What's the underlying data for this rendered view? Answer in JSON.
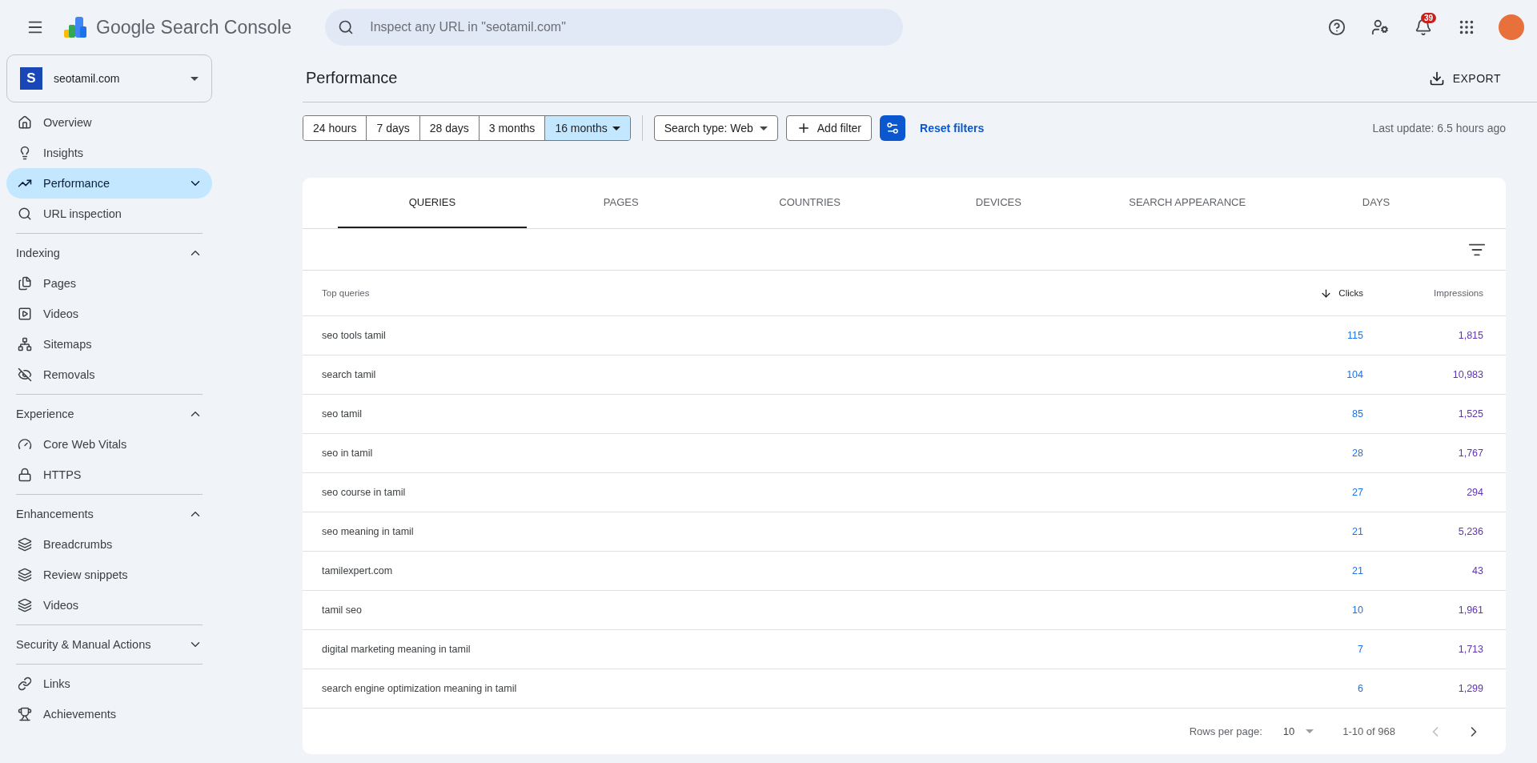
{
  "header": {
    "product": "Google Search Console",
    "search": {
      "placeholder": "Inspect any URL in \"seotamil.com\""
    },
    "notifications": "39"
  },
  "property": {
    "letter": "S",
    "name": "seotamil.com"
  },
  "sidebar": {
    "groups": [
      {
        "items": [
          {
            "label": "Overview",
            "kind": "home",
            "selected": false,
            "expandable": false
          },
          {
            "label": "Insights",
            "kind": "bulb",
            "selected": false,
            "expandable": false
          },
          {
            "label": "Performance",
            "kind": "trend",
            "selected": true,
            "expandable": true
          },
          {
            "label": "URL inspection",
            "kind": "search",
            "selected": false,
            "expandable": false
          }
        ]
      },
      {
        "title": "Indexing",
        "expanded": true,
        "items": [
          {
            "label": "Pages",
            "kind": "pages",
            "selected": false,
            "expandable": false
          },
          {
            "label": "Videos",
            "kind": "video",
            "selected": false,
            "expandable": false
          },
          {
            "label": "Sitemaps",
            "kind": "sitemap",
            "selected": false,
            "expandable": false
          },
          {
            "label": "Removals",
            "kind": "hidden",
            "selected": false,
            "expandable": false
          }
        ]
      },
      {
        "title": "Experience",
        "expanded": true,
        "items": [
          {
            "label": "Core Web Vitals",
            "kind": "gauge",
            "selected": false,
            "expandable": false
          },
          {
            "label": "HTTPS",
            "kind": "lock",
            "selected": false,
            "expandable": false
          }
        ]
      },
      {
        "title": "Enhancements",
        "expanded": true,
        "items": [
          {
            "label": "Breadcrumbs",
            "kind": "layers",
            "selected": false,
            "expandable": false
          },
          {
            "label": "Review snippets",
            "kind": "layers",
            "selected": false,
            "expandable": false
          },
          {
            "label": "Videos",
            "kind": "layers",
            "selected": false,
            "expandable": false
          }
        ]
      },
      {
        "title": "Security & Manual Actions",
        "expanded": false
      },
      {
        "items": [
          {
            "label": "Links",
            "kind": "link",
            "selected": false,
            "expandable": false
          },
          {
            "label": "Achievements",
            "kind": "trophy",
            "selected": false,
            "expandable": false
          }
        ]
      }
    ]
  },
  "page": {
    "title": "Performance",
    "export": "EXPORT"
  },
  "filters": {
    "ranges": [
      {
        "label": "24 hours",
        "selected": false
      },
      {
        "label": "7 days",
        "selected": false
      },
      {
        "label": "28 days",
        "selected": false
      },
      {
        "label": "3 months",
        "selected": false
      },
      {
        "label": "16 months",
        "selected": true
      }
    ],
    "search_type": "Search type: Web",
    "add_filter": "Add filter",
    "reset": "Reset filters",
    "last_update": "Last update: 6.5 hours ago"
  },
  "tabs": [
    {
      "label": "QUERIES",
      "selected": true
    },
    {
      "label": "PAGES",
      "selected": false
    },
    {
      "label": "COUNTRIES",
      "selected": false
    },
    {
      "label": "DEVICES",
      "selected": false
    },
    {
      "label": "SEARCH APPEARANCE",
      "selected": false
    },
    {
      "label": "DAYS",
      "selected": false
    }
  ],
  "table": {
    "columns": [
      {
        "label": "Top queries",
        "sorted": false
      },
      {
        "label": "Clicks",
        "sorted": true
      },
      {
        "label": "Impressions",
        "sorted": false
      }
    ],
    "rows": [
      {
        "query": "seo tools tamil",
        "clicks": "115",
        "impressions": "1,815"
      },
      {
        "query": "search tamil",
        "clicks": "104",
        "impressions": "10,983"
      },
      {
        "query": "seo tamil",
        "clicks": "85",
        "impressions": "1,525"
      },
      {
        "query": "seo in tamil",
        "clicks": "28",
        "impressions": "1,767"
      },
      {
        "query": "seo course in tamil",
        "clicks": "27",
        "impressions": "294"
      },
      {
        "query": "seo meaning in tamil",
        "clicks": "21",
        "impressions": "5,236"
      },
      {
        "query": "tamilexpert.com",
        "clicks": "21",
        "impressions": "43"
      },
      {
        "query": "tamil seo",
        "clicks": "10",
        "impressions": "1,961"
      },
      {
        "query": "digital marketing meaning in tamil",
        "clicks": "7",
        "impressions": "1,713"
      },
      {
        "query": "search engine optimization meaning in tamil",
        "clicks": "6",
        "impressions": "1,299"
      }
    ]
  },
  "pagination": {
    "rows_label": "Rows per page:",
    "rows_value": "10",
    "range": "1-10 of 968"
  }
}
